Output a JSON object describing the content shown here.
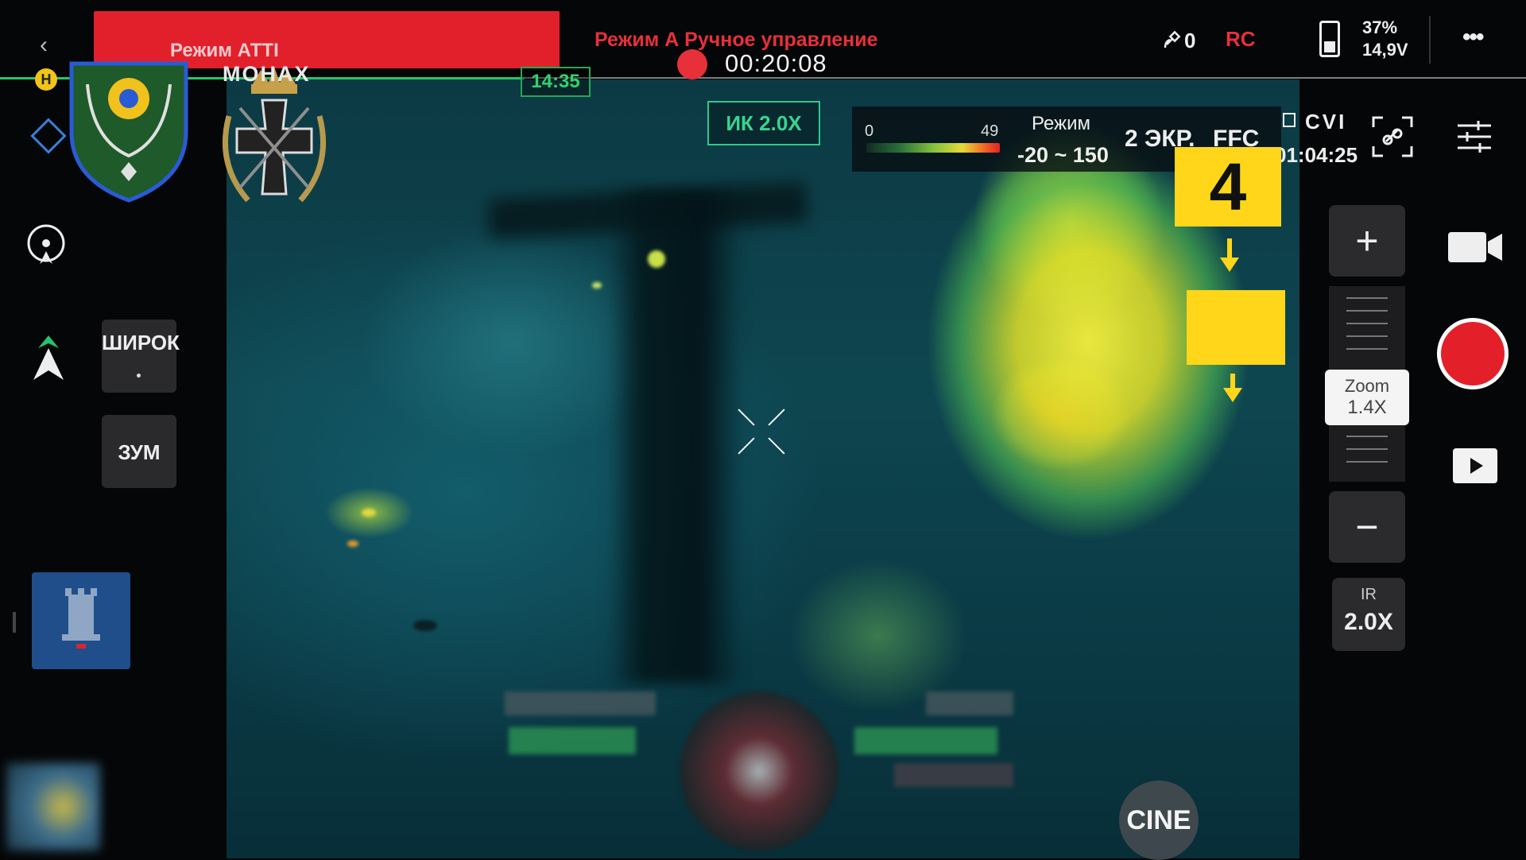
{
  "header": {
    "banner_mode": "Режим АТТІ",
    "mode_status": "Режим А   Ручное управление",
    "flight_time": "14:35",
    "recording_time": "00:20:08",
    "gps_count": "0",
    "rc_label": "RC",
    "battery_percent": "37%",
    "battery_voltage": "14,9V",
    "more_label": "•••"
  },
  "thermal": {
    "camera_zoom": "ИК 2.0X",
    "scale_min": "0",
    "scale_max": "49",
    "mode_label": "Режим",
    "range": "-20 ~ 150",
    "screen_label": "2 ЭКР.",
    "ffc_label": "FFC",
    "cvi_label": "CVI",
    "storage_time": "01:04:25"
  },
  "left_panel": {
    "home_marker": "H",
    "unit_logo_text": "МОНАХ",
    "wide_button": "ШИРОК",
    "zoom_button": "ЗУМ"
  },
  "right_panel": {
    "zoom_label": "Zoom",
    "zoom_value": "1.4X",
    "ir_label": "IR",
    "ir_value": "2.0X",
    "plus": "+",
    "minus": "−"
  },
  "overlay": {
    "annotation_number": "4",
    "cine_label": "CINE"
  },
  "colors": {
    "accent_red": "#e8303a",
    "accent_green": "#2ec98b",
    "annotation_yellow": "#ffd61a"
  }
}
